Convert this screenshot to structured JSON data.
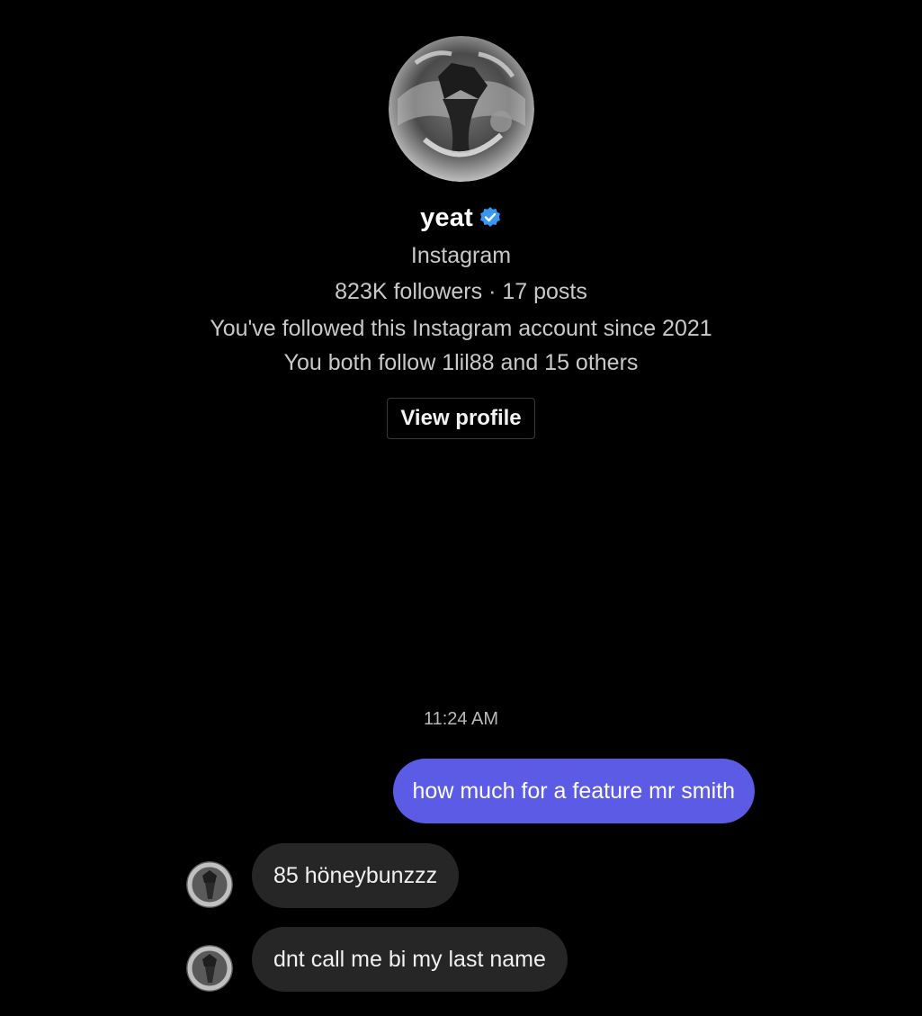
{
  "profile": {
    "username": "yeat",
    "verified_icon": "verified-badge-icon",
    "platform": "Instagram",
    "stats": "823K followers · 17 posts",
    "followed_since": "You've followed this Instagram account since 2021",
    "mutuals": "You both follow 1lil88 and 15 others",
    "view_profile_label": "View profile"
  },
  "conversation": {
    "timestamp": "11:24 AM",
    "messages": [
      {
        "direction": "outgoing",
        "text": "how much for a feature mr smith"
      },
      {
        "direction": "incoming",
        "text": "85 höneybunzzz"
      },
      {
        "direction": "incoming",
        "text": "dnt call me bi my last name"
      }
    ]
  },
  "colors": {
    "background": "#000000",
    "outgoing_bubble": "#5b5be6",
    "incoming_bubble": "#262626",
    "verified_badge": "#3897f0",
    "secondary_text": "#c9c9c9"
  }
}
